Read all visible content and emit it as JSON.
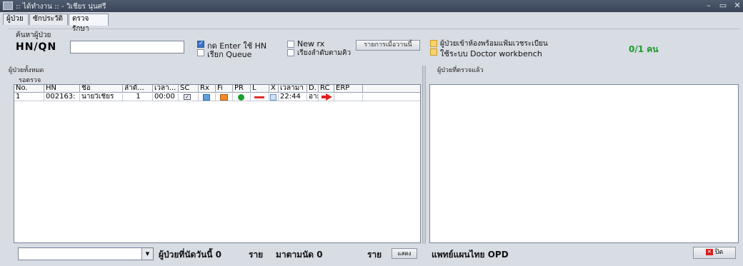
{
  "window": {
    "title": ":: ได้ทำงาน :: - วิเชียร นุ่นศรี",
    "min": "–",
    "max": "▭",
    "close": "✕"
  },
  "tabs": [
    {
      "label": "ผู้ป่วย"
    },
    {
      "label": "ซักประวัติ"
    },
    {
      "label": "ตรวจรักษา"
    }
  ],
  "search": {
    "group_title": "ค้นหาผู้ป่วย",
    "hn_label": "HN/QN",
    "hn_value": "",
    "opt_enter": "กด Enter ใช้ HN",
    "opt_queue": "เรียก Queue",
    "opt_newrx": "New rx",
    "opt_sort": "เรียงลำดับตามคิว",
    "btn_today": "รายการเมื่อวานนี้",
    "opt_room": "ผู้ป่วยเข้าห้องพร้อมแฟ้มเวชระเบียน",
    "opt_workbench": "ใช้ระบบ Doctor workbench",
    "counter": "0/1 คน"
  },
  "left_panel": {
    "title": "ผู้ป่วยทั้งหมด",
    "sub_title": "รอตรวจ",
    "columns": [
      "No.",
      "HN",
      "ชื่อ",
      "ลำดั...",
      "เวลา...",
      "SC",
      "Rx",
      "Fi",
      "PR",
      "L",
      "X",
      "เวลามา",
      "D.",
      "RC",
      "ERP"
    ],
    "rows": [
      {
        "no": "1",
        "hn": "002163:",
        "name": "นายวิเชียร",
        "seq": "1",
        "time": "00:00",
        "arrive": "22:44",
        "d": "อายุ"
      }
    ]
  },
  "right_panel": {
    "title": "ผู้ป่วยที่ตรวจแล้ว",
    "footer_label": "แพทย์แผนไทย OPD",
    "close_btn": "ปิด"
  },
  "bottom": {
    "combo_value": "",
    "appt_label": "ผู้ป่วยที่นัดวันนี้ 0",
    "unit1": "ราย",
    "came_label": "มาตามนัด 0",
    "unit2": "ราย",
    "show_btn": "แสดง"
  },
  "colors": {
    "accent_green": "#1a9a2a",
    "rc_red": "#e02020"
  }
}
